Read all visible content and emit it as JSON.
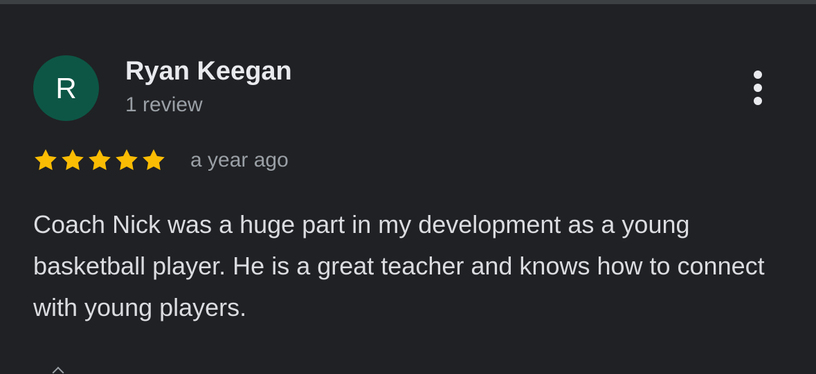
{
  "review": {
    "avatar_letter": "R",
    "avatar_color": "#0d5645",
    "reviewer_name": "Ryan Keegan",
    "review_count": "1 review",
    "rating": 5,
    "rating_max": 5,
    "star_color": "#fbbc04",
    "date": "a year ago",
    "text": "Coach Nick was a huge part in my development as a young basketball player. He is a great teacher and knows how to connect with young players.",
    "more_icon": "more-vert-icon"
  },
  "theme": {
    "background": "#202124",
    "name_color": "#e8eaed",
    "meta_color": "#9aa0a6",
    "text_color": "#dadce0"
  }
}
